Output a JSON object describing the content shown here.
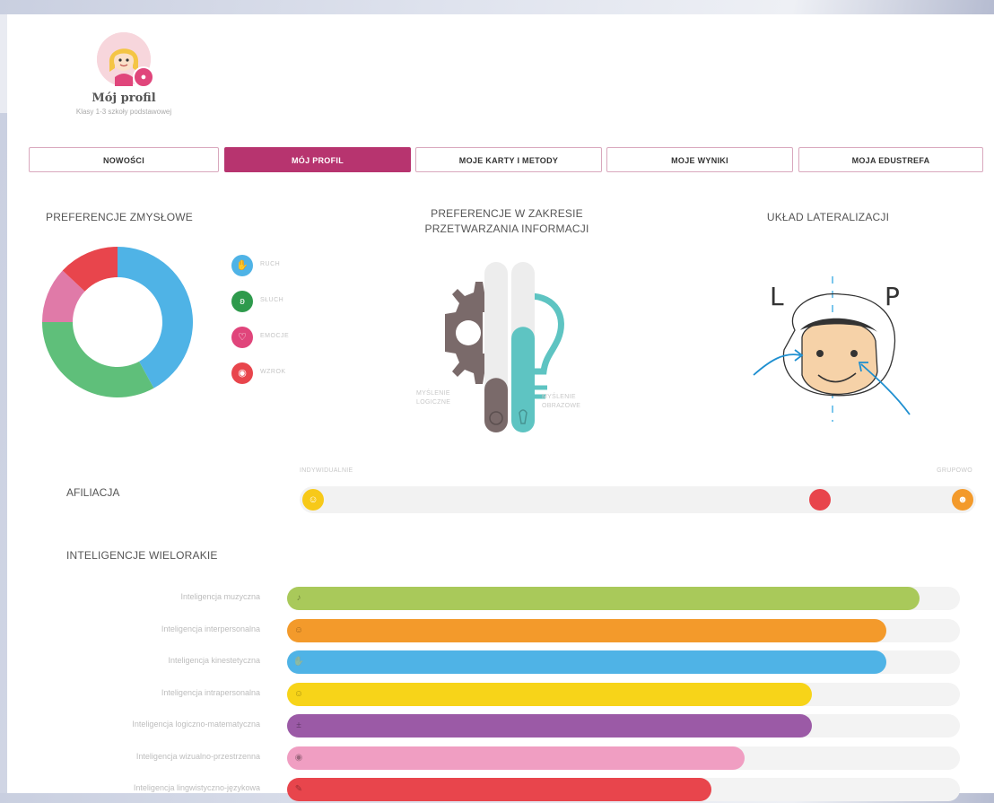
{
  "profile": {
    "name": "Mój profil",
    "subtitle": "Klasy 1-3 szkoły podstawowej",
    "pin_icon": "location-pin-icon"
  },
  "tabs": [
    {
      "label": "NOWOŚCI",
      "active": false
    },
    {
      "label": "MÓJ PROFIL",
      "active": true
    },
    {
      "label": "MOJE KARTY I METODY",
      "active": false
    },
    {
      "label": "MOJE WYNIKI",
      "active": false
    },
    {
      "label": "MOJA EDUSTREFA",
      "active": false
    }
  ],
  "colors": {
    "accent": "#b7346f",
    "blue": "#4fb3e6",
    "green": "#5fbf7a",
    "pink": "#e07aa8",
    "red": "#e8454c",
    "gray_brown": "#7a6a6a",
    "teal": "#5ec4c2",
    "yellow": "#f7c919",
    "orange": "#f39a2b"
  },
  "sensory": {
    "title": "PREFERENCJE ZMYSŁOWE",
    "legend": [
      {
        "label": "RUCH",
        "icon": "hand-icon",
        "color": "#4fb3e6"
      },
      {
        "label": "SŁUCH",
        "icon": "ear-icon",
        "color": "#2e9a4c"
      },
      {
        "label": "EMOCJE",
        "icon": "heart-icon",
        "color": "#e0457b"
      },
      {
        "label": "WZROK",
        "icon": "eye-icon",
        "color": "#e8454c"
      }
    ]
  },
  "chart_data": {
    "type": "pie",
    "labels": [
      "RUCH",
      "SŁUCH",
      "EMOCJE",
      "WZROK"
    ],
    "values": [
      42,
      33,
      12,
      13
    ],
    "colors": [
      "#4fb3e6",
      "#5fbf7a",
      "#e07aa8",
      "#e8454c"
    ],
    "title": "PREFERENCJE ZMYSŁOWE"
  },
  "processing": {
    "title_line1": "PREFERENCJE W ZAKRESIE",
    "title_line2": "PRZETWARZANIA INFORMACJI",
    "left_label_line1": "MYŚLENIE",
    "left_label_line2": "LOGICZNE",
    "right_label_line1": "MYŚLENIE",
    "right_label_line2": "OBRAZOWE",
    "left_value": 0.32,
    "right_value": 0.62,
    "left_icon": "gear-icon",
    "right_icon": "lightbulb-icon"
  },
  "lateralization": {
    "title": "UKŁAD LATERALIZACJI",
    "left_letter": "L",
    "right_letter": "P",
    "image_icon": "face-lateralization-icon"
  },
  "affiliation": {
    "label": "AFILIACJA",
    "left_end": "INDYWIDUALNIE",
    "right_end": "GRUPOWO",
    "markers": [
      {
        "name": "start",
        "value": 0.0,
        "color": "#f7c919",
        "icon": "person-icon"
      },
      {
        "name": "result",
        "value": 0.78,
        "color": "#e8454c",
        "icon": ""
      },
      {
        "name": "end",
        "value": 1.0,
        "color": "#f39a2b",
        "icon": "group-icon"
      }
    ]
  },
  "intelligences": {
    "title": "INTELIGENCJE WIELORAKIE",
    "items": [
      {
        "label": "Inteligencja muzyczna",
        "value": 0.94,
        "color": "#a9c95a",
        "icon": "music-icon"
      },
      {
        "label": "Inteligencja interpersonalna",
        "value": 0.89,
        "color": "#f39a2b",
        "icon": "people-icon"
      },
      {
        "label": "Inteligencja kinestetyczna",
        "value": 0.89,
        "color": "#4fb3e6",
        "icon": "hand-icon"
      },
      {
        "label": "Inteligencja intrapersonalna",
        "value": 0.78,
        "color": "#f7d419",
        "icon": "person-icon"
      },
      {
        "label": "Inteligencja logiczno-matematyczna",
        "value": 0.78,
        "color": "#9b5aa6",
        "icon": "math-icon"
      },
      {
        "label": "Inteligencja wizualno-przestrzenna",
        "value": 0.68,
        "color": "#f09ec2",
        "icon": "eye-icon"
      },
      {
        "label": "Inteligencja lingwistyczno-językowa",
        "value": 0.63,
        "color": "#e8454c",
        "icon": "speech-icon"
      }
    ]
  }
}
